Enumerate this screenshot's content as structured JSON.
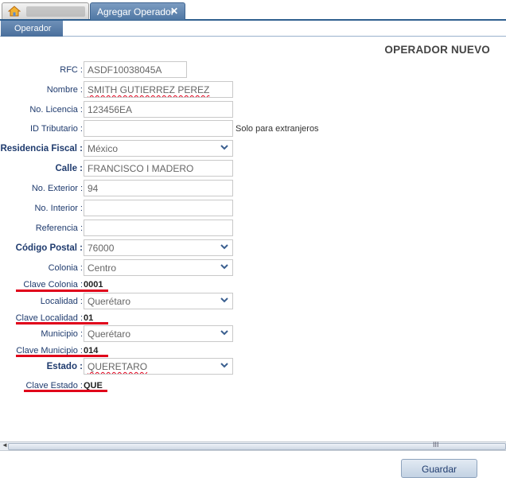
{
  "tabs": {
    "active_label": "Agregar Operador",
    "close_glyph": "✕"
  },
  "subtab": {
    "label": "Operador"
  },
  "form": {
    "title": "OPERADOR NUEVO",
    "rfc": {
      "label": "RFC :",
      "value": "ASDF10038045A"
    },
    "nombre": {
      "label": "Nombre :",
      "value": "SMITH GUTIERREZ PEREZ"
    },
    "licencia": {
      "label": "No. Licencia :",
      "value": "123456EA"
    },
    "id_tributario": {
      "label": "ID Tributario :",
      "value": "",
      "hint": "Solo para extranjeros"
    },
    "residencia": {
      "label": "Residencia Fiscal :",
      "value": "México"
    },
    "calle": {
      "label": "Calle :",
      "value": "FRANCISCO I MADERO"
    },
    "exterior": {
      "label": "No. Exterior :",
      "value": "94"
    },
    "interior": {
      "label": "No. Interior :",
      "value": ""
    },
    "referencia": {
      "label": "Referencia :",
      "value": ""
    },
    "codigo_postal": {
      "label": "Código Postal :",
      "value": "76000"
    },
    "colonia": {
      "label": "Colonia :",
      "value": "Centro"
    },
    "clave_colonia": {
      "label": "Clave Colonia :",
      "value": "0001"
    },
    "localidad": {
      "label": "Localidad :",
      "value": "Querétaro"
    },
    "clave_localidad": {
      "label": "Clave Localidad :",
      "value": "01"
    },
    "municipio": {
      "label": "Municipio :",
      "value": "Querétaro"
    },
    "clave_municipio": {
      "label": "Clave Municipio :",
      "value": "014"
    },
    "estado": {
      "label": "Estado :",
      "value": "QUERETARO"
    },
    "clave_estado": {
      "label": "Clave Estado :",
      "value": "QUE"
    }
  },
  "scrollbar": {
    "grip": "III"
  },
  "footer": {
    "save_label": "Guardar"
  },
  "colors": {
    "accent": "#4f77a4",
    "highlight": "#e0001a",
    "label": "#1f3b6e"
  },
  "icons": {
    "home": "home-icon",
    "chevron": "chevron-down-icon"
  }
}
